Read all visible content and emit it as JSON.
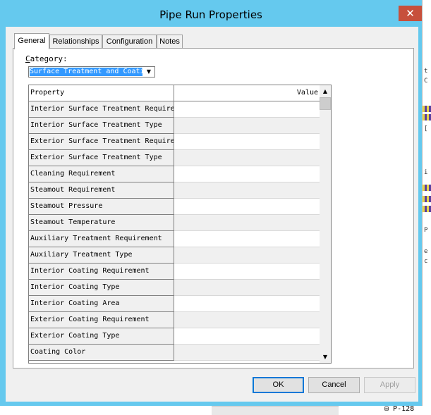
{
  "window": {
    "title": "Pipe Run Properties",
    "close_glyph": "✕"
  },
  "tabs": [
    {
      "label": "General",
      "active": true
    },
    {
      "label": "Relationships",
      "active": false
    },
    {
      "label": "Configuration",
      "active": false
    },
    {
      "label": "Notes",
      "active": false
    }
  ],
  "category": {
    "label_underlined": "C",
    "label_rest": "ategory:",
    "selected": "Surface Treatment and Coati"
  },
  "grid": {
    "columns": {
      "property": "Property",
      "value": "Value"
    },
    "rows": [
      "Interior Surface Treatment Requirement",
      "Interior Surface Treatment Type",
      "Exterior Surface Treatment Requirement",
      "Exterior Surface Treatment Type",
      "Cleaning Requirement",
      "Steamout Requirement",
      "Steamout Pressure",
      "Steamout Temperature",
      "Auxiliary Treatment Requirement",
      "Auxiliary Treatment Type",
      "Interior Coating Requirement",
      "Interior Coating Type",
      "Interior Coating Area",
      "Exterior Coating Requirement",
      "Exterior Coating Type",
      "Coating Color"
    ]
  },
  "buttons": {
    "ok": "OK",
    "cancel": "Cancel",
    "apply": "Apply"
  },
  "background": {
    "tree_label": "P-128"
  },
  "icons": {
    "dropdown": "chevron-down-icon",
    "scroll_up": "scroll-up-arrow-icon",
    "scroll_down": "scroll-down-arrow-icon",
    "close": "close-icon"
  }
}
